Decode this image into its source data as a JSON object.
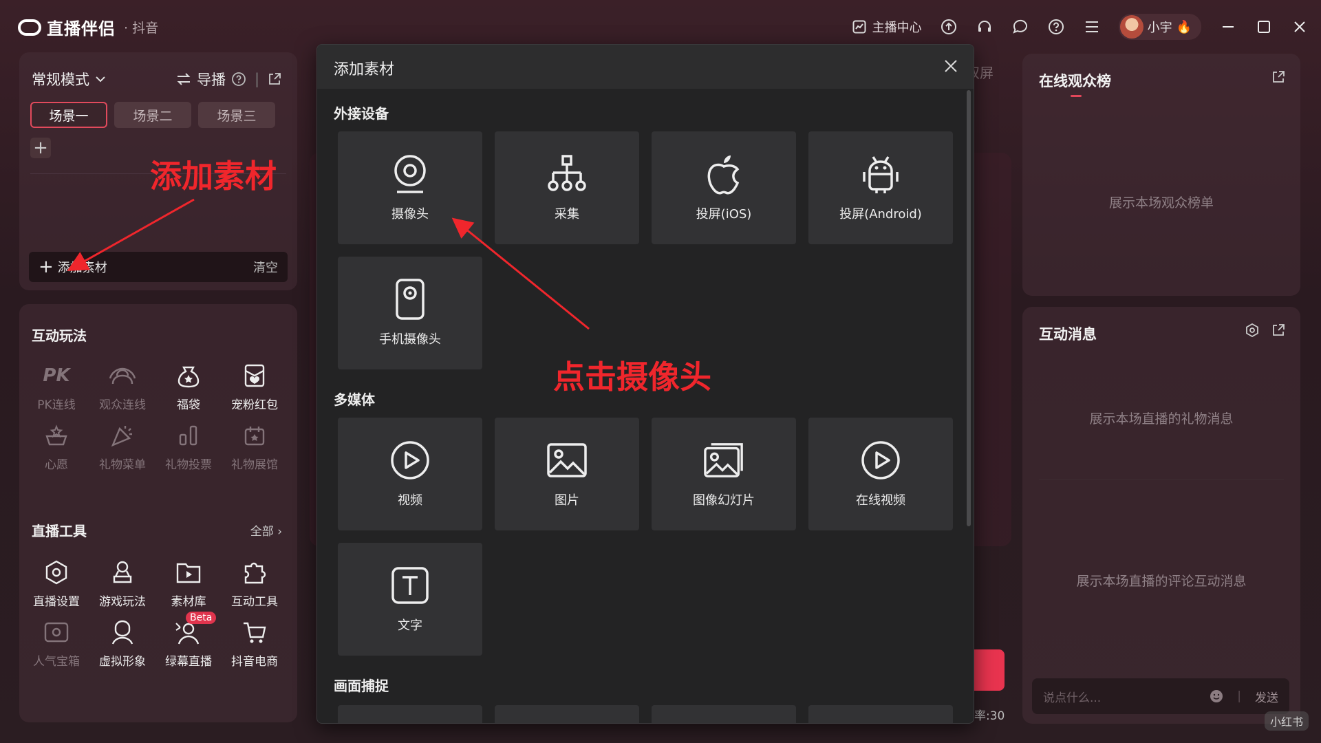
{
  "titlebar": {
    "app_name": "直播伴侣",
    "app_sub": "· 抖音",
    "host_center": "主播中心",
    "user_name": "小宇"
  },
  "scene_panel": {
    "mode": "常规模式",
    "director": "导播",
    "tabs": [
      "场景一",
      "场景二",
      "场景三"
    ],
    "add_material": "添加素材",
    "clear": "清空"
  },
  "interact": {
    "title": "互动玩法",
    "items": [
      {
        "label": "PK连线",
        "icon": "pk-icon"
      },
      {
        "label": "观众连线",
        "icon": "audience-link-icon"
      },
      {
        "label": "福袋",
        "icon": "lucky-bag-icon"
      },
      {
        "label": "宠粉红包",
        "icon": "red-envelope-icon"
      },
      {
        "label": "心愿",
        "icon": "wish-icon"
      },
      {
        "label": "礼物菜单",
        "icon": "gift-menu-icon"
      },
      {
        "label": "礼物投票",
        "icon": "gift-vote-icon"
      },
      {
        "label": "礼物展馆",
        "icon": "gift-hall-icon"
      }
    ]
  },
  "tools": {
    "title": "直播工具",
    "all": "全部",
    "items": [
      {
        "label": "直播设置",
        "icon": "settings-hex-icon"
      },
      {
        "label": "游戏玩法",
        "icon": "game-icon"
      },
      {
        "label": "素材库",
        "icon": "material-folder-icon"
      },
      {
        "label": "互动工具",
        "icon": "puzzle-icon"
      },
      {
        "label": "人气宝箱",
        "icon": "treasure-box-icon"
      },
      {
        "label": "虚拟形象",
        "icon": "avatar-figure-icon"
      },
      {
        "label": "绿幕直播",
        "icon": "green-screen-icon"
      },
      {
        "label": "抖音电商",
        "icon": "cart-icon"
      }
    ],
    "beta": "Beta"
  },
  "modal": {
    "title": "添加素材",
    "sections": {
      "devices": "外接设备",
      "media": "多媒体",
      "capture": "画面捕捉"
    },
    "device_tiles": [
      "摄像头",
      "采集",
      "投屏(iOS)",
      "投屏(Android)",
      "手机摄像头"
    ],
    "media_tiles": [
      "视频",
      "图片",
      "图像幻灯片",
      "在线视频",
      "文字"
    ]
  },
  "right": {
    "audience_title": "在线观众榜",
    "audience_empty": "展示本场观众榜单",
    "messages_title": "互动消息",
    "gift_empty": "展示本场直播的礼物消息",
    "comment_empty": "展示本场直播的评论互动消息",
    "chat_placeholder": "说点什么...",
    "send": "发送"
  },
  "center": {
    "peek_label": "双屏",
    "rate": "率:30"
  },
  "annotations": {
    "add_material": "添加素材",
    "click_camera": "点击摄像头"
  },
  "watermark": "小红书",
  "colors": {
    "accent": "#e8344f",
    "annotation": "#f0262c"
  }
}
